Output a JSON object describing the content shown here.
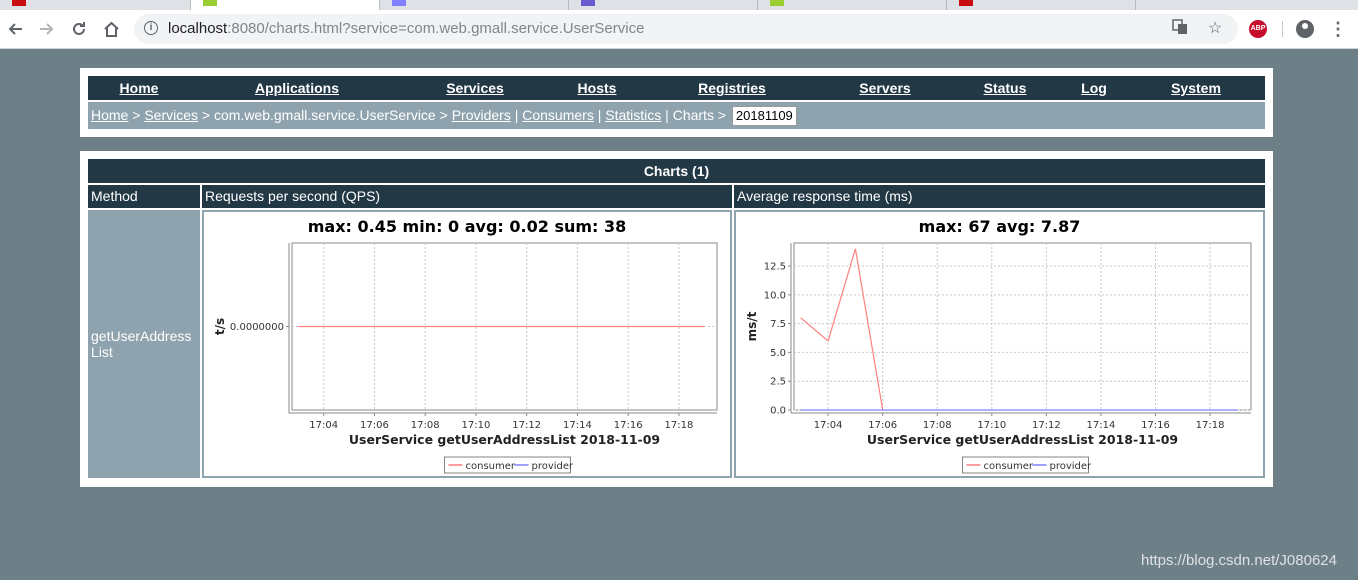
{
  "browser": {
    "url_host": "localhost",
    "url_rest": ":8080/charts.html?service=com.web.gmall.service.UserService",
    "abp_label": "ABP"
  },
  "nav": {
    "items": [
      "Home",
      "Applications",
      "Services",
      "Hosts",
      "Registries",
      "Servers",
      "Status",
      "Log",
      "System"
    ]
  },
  "breadcrumb": {
    "home": "Home",
    "services": "Services",
    "service_name": "com.web.gmall.service.UserService",
    "providers": "Providers",
    "consumers": "Consumers",
    "statistics": "Statistics",
    "charts": "Charts",
    "date": "20181109"
  },
  "table": {
    "caption": "Charts (1)",
    "headers": [
      "Method",
      "Requests per second (QPS)",
      "Average response time (ms)"
    ],
    "method": "getUserAddressList"
  },
  "watermark": "https://blog.csdn.net/J080624",
  "colors": {
    "consumer": "#ff8080",
    "provider": "#8080ff",
    "header": "#233845",
    "sub": "#8ea3ad"
  },
  "chart_data": [
    {
      "type": "line",
      "title": "max: 0.45 min: 0 avg: 0.02 sum: 38",
      "xlabel": "UserService  getUserAddressList  2018-11-09",
      "ylabel": "t/s",
      "x_ticks": [
        "17:04",
        "17:06",
        "17:08",
        "17:10",
        "17:12",
        "17:14",
        "17:16",
        "17:18"
      ],
      "x_range": [
        "17:02:45",
        "17:19:30"
      ],
      "y_ticks": [
        "0.0000000"
      ],
      "y_range": [
        -1e-07,
        1e-07
      ],
      "grid": true,
      "legend": "bottom-center",
      "series": [
        {
          "name": "consumer",
          "x": [
            "17:03",
            "17:19"
          ],
          "values": [
            0,
            0
          ]
        },
        {
          "name": "provider",
          "x": [],
          "values": []
        }
      ]
    },
    {
      "type": "line",
      "title": "max: 67 avg: 7.87",
      "xlabel": "UserService  getUserAddressList  2018-11-09",
      "ylabel": "ms/t",
      "x_ticks": [
        "17:04",
        "17:06",
        "17:08",
        "17:10",
        "17:12",
        "17:14",
        "17:16",
        "17:18"
      ],
      "x_range": [
        "17:02:45",
        "17:19:30"
      ],
      "y_ticks": [
        "0.0",
        "2.5",
        "5.0",
        "7.5",
        "10.0",
        "12.5"
      ],
      "y_range": [
        0,
        14.5
      ],
      "grid": true,
      "legend": "bottom-center",
      "series": [
        {
          "name": "consumer",
          "x": [
            "17:03",
            "17:04",
            "17:05",
            "17:06"
          ],
          "values": [
            8,
            6,
            14,
            0
          ]
        },
        {
          "name": "provider",
          "x": [
            "17:03",
            "17:19"
          ],
          "values": [
            0,
            0
          ]
        }
      ]
    }
  ]
}
